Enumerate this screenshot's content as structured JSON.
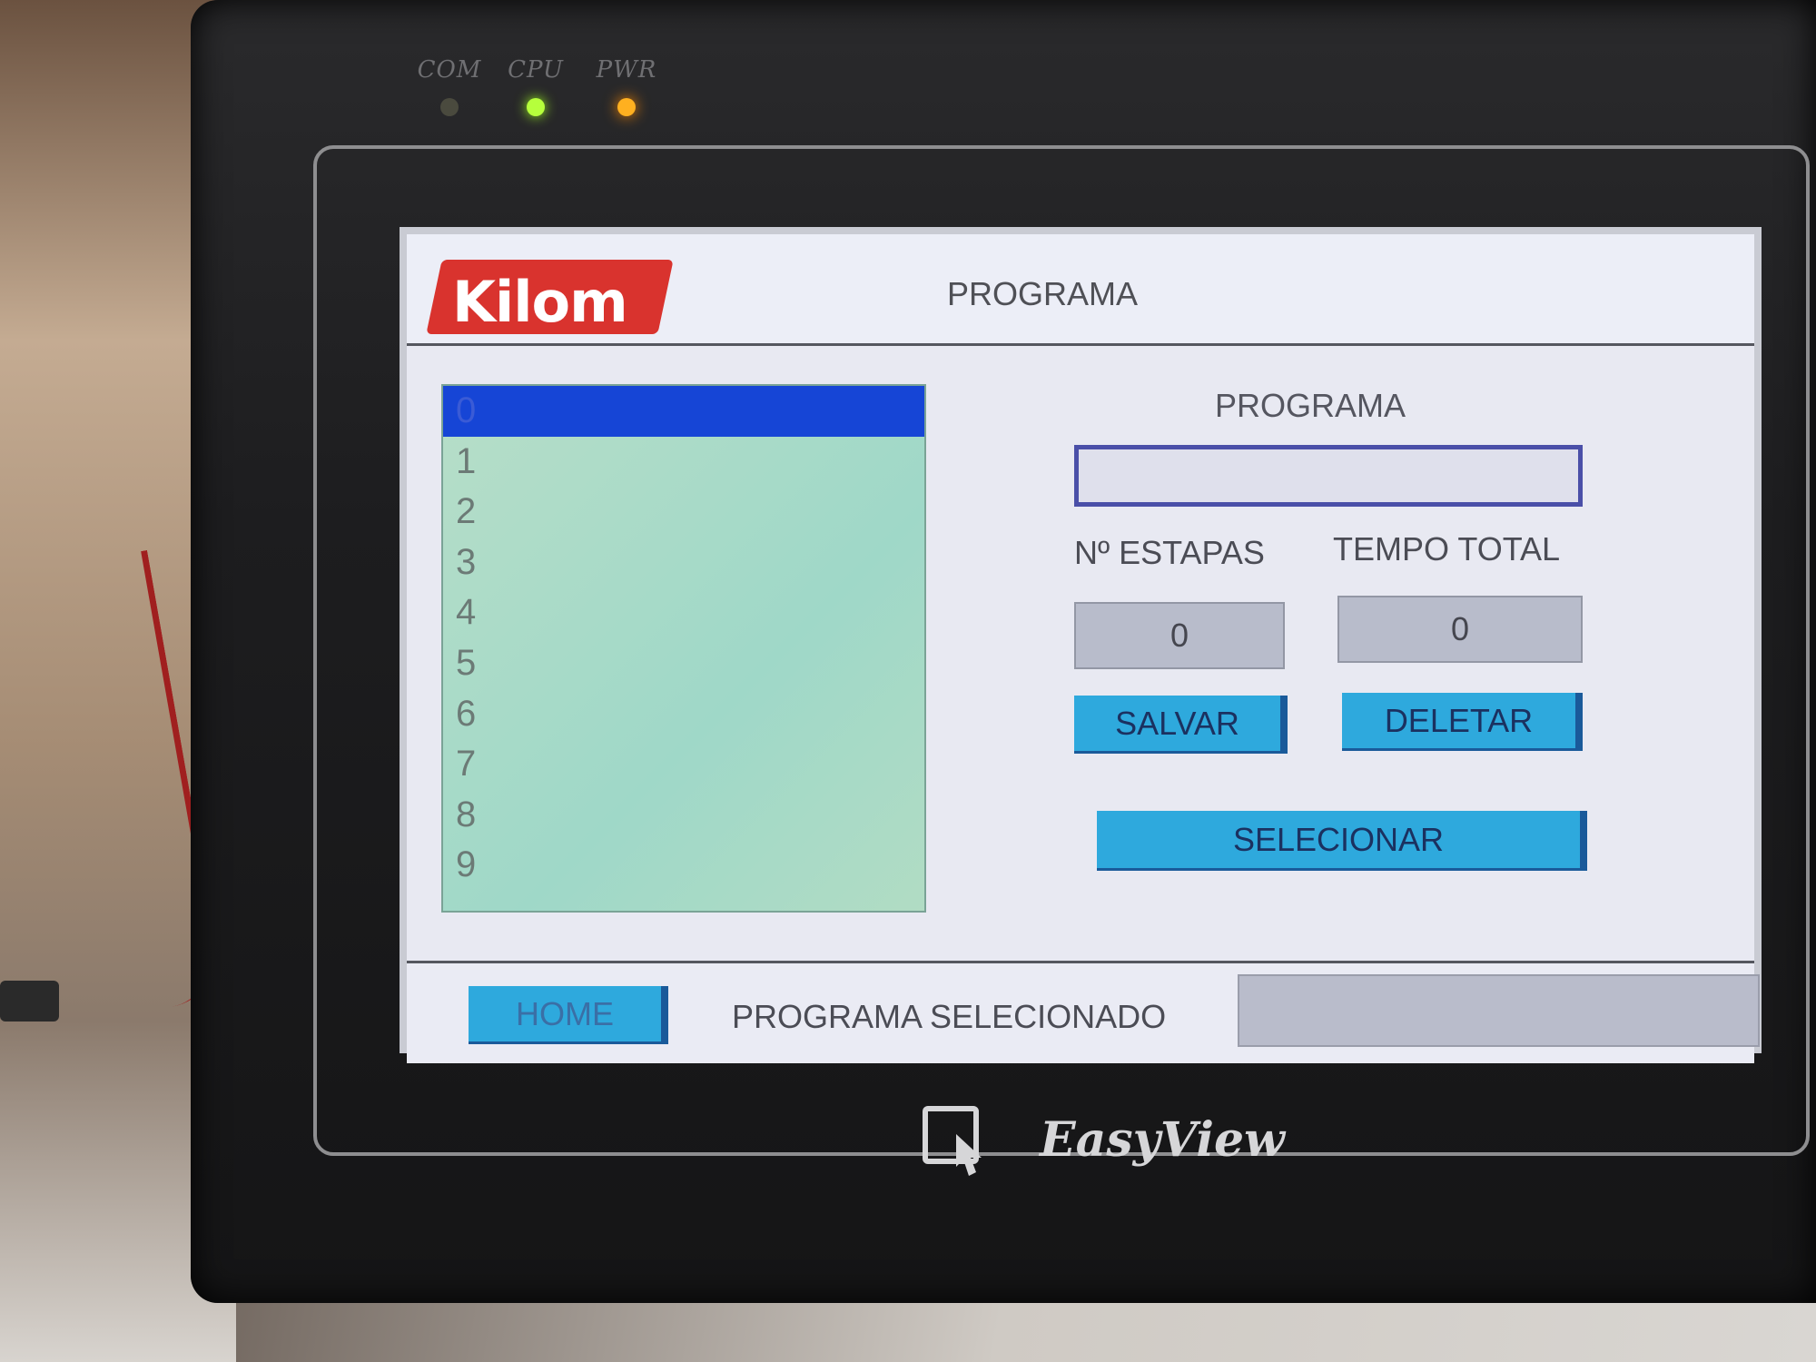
{
  "leds": [
    {
      "label": "COM",
      "state": "off",
      "color": "#4a4a3e"
    },
    {
      "label": "CPU",
      "state": "on",
      "color": "#b6ff3c"
    },
    {
      "label": "PWR",
      "state": "on",
      "color": "#ffb020"
    }
  ],
  "header": {
    "logo_text": "Kilom",
    "title": "PROGRAMA"
  },
  "program_list": {
    "items": [
      "0",
      "1",
      "2",
      "3",
      "4",
      "5",
      "6",
      "7",
      "8",
      "9"
    ],
    "selected_index": 0
  },
  "form": {
    "program_label": "PROGRAMA",
    "program_value": "",
    "steps_label": "Nº ESTAPAS",
    "steps_value": "0",
    "total_time_label": "TEMPO TOTAL",
    "total_time_value": "0"
  },
  "buttons": {
    "save": "SALVAR",
    "delete": "DELETAR",
    "select": "SELECIONAR",
    "home": "HOME"
  },
  "footer": {
    "selected_program_label": "PROGRAMA SELECIONADO",
    "selected_program_value": ""
  },
  "device_brand": "EasyView",
  "colors": {
    "button": "#2ea9dd",
    "selection": "#1645d6",
    "list_background": "#a8dcc8",
    "logo": "#d9332e"
  }
}
